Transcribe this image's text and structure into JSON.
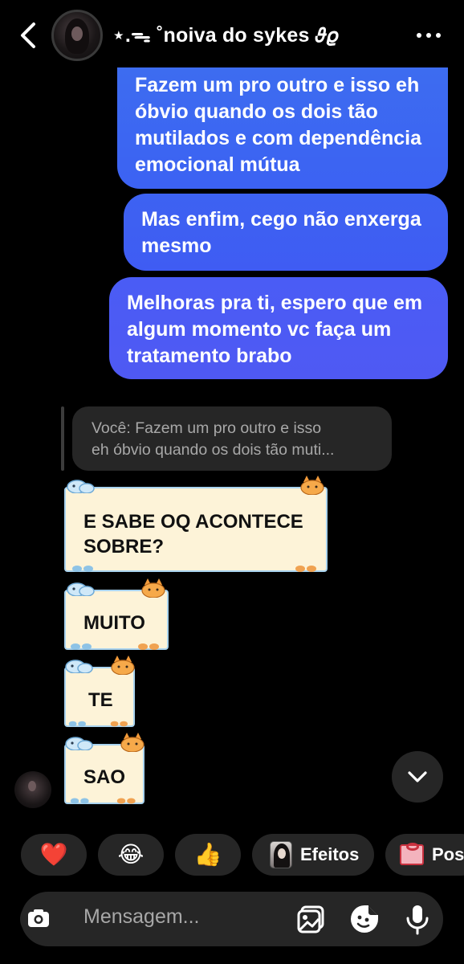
{
  "header": {
    "chat_name": "⋆.ᯓ ˚noiva do sykes 𝜗𝜚",
    "back_icon": "chevron-left-icon",
    "more_icon": "more-horizontal-icon"
  },
  "messages": {
    "outgoing": [
      {
        "text": "Fazem um pro outro e isso eh\nóbvio quando os dois tão\nmutilados e com dependência\nemocional mútua"
      },
      {
        "text": "Mas enfim, cego não enxerga\nmesmo"
      },
      {
        "text": "Melhoras pra ti, espero que em\nalgum momento vc faça um\ntratamento brabo"
      }
    ],
    "reply_quote": "Você: Fazem um pro outro e isso\neh óbvio quando os dois tão muti...",
    "incoming": [
      {
        "text": "E SABE OQ ACONTECE\nSOBRE?"
      },
      {
        "text": "MUITO"
      },
      {
        "text": "TE"
      },
      {
        "text": "SAO"
      }
    ]
  },
  "reactions": {
    "heart": "❤️",
    "laugh": "😂",
    "thumbs_up": "👍",
    "effects_label": "Efeitos",
    "post_label": "Post"
  },
  "composer": {
    "placeholder": "Mensagem..."
  },
  "colors": {
    "background": "#000000",
    "bubble_blue": "#3c62f3",
    "bubble_purple_blue": "#4f59f3",
    "pill_gray": "#262626",
    "sticker_cream": "#fdf3d8",
    "sticker_border": "#a9d3ef"
  }
}
